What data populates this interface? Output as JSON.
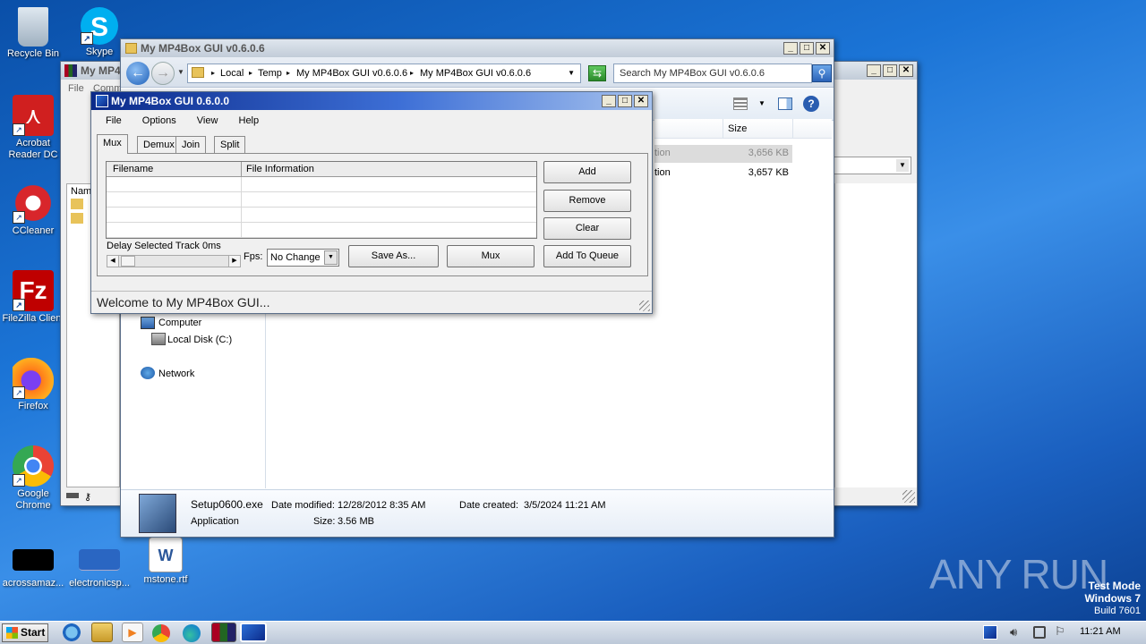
{
  "desktop_icons": [
    {
      "label": "Recycle Bin"
    },
    {
      "label": "Skype"
    },
    {
      "label": "Acrobat Reader DC"
    },
    {
      "label": "CCleaner"
    },
    {
      "label": "FileZilla Client"
    },
    {
      "label": "Firefox"
    },
    {
      "label": "Google Chrome"
    },
    {
      "label": "acrossamaz..."
    },
    {
      "label": "electronicsp..."
    },
    {
      "label": "mstone.rtf"
    }
  ],
  "back_window": {
    "title": "My MP4",
    "menu_file": "File",
    "menu_comm": "Comm",
    "col_name": "Name"
  },
  "explorer": {
    "title": "My MP4Box GUI v0.6.0.6",
    "address": [
      "Local",
      "Temp",
      "My MP4Box GUI v0.6.0.6",
      "My MP4Box GUI v0.6.0.6"
    ],
    "search_placeholder": "Search My MP4Box GUI v0.6.0.6",
    "col_size": "Size",
    "files": [
      {
        "type": "tion",
        "size": "3,656 KB"
      },
      {
        "type": "tion",
        "size": "3,657 KB"
      }
    ],
    "nav": {
      "computer": "Computer",
      "local_disk": "Local Disk (C:)",
      "network": "Network"
    },
    "details": {
      "filename": "Setup0600.exe",
      "type": "Application",
      "date_modified_label": "Date modified:",
      "date_modified": "12/28/2012 8:35 AM",
      "date_created_label": "Date created:",
      "date_created": "3/5/2024 11:21 AM",
      "size_label": "Size:",
      "size": "3.56 MB"
    }
  },
  "mp4box": {
    "title": "My MP4Box GUI 0.6.0.0",
    "menu": [
      "File",
      "Options",
      "View",
      "Help"
    ],
    "tabs": [
      "Mux",
      "Demux",
      "Join",
      "Split"
    ],
    "grid_headers": [
      "Filename",
      "File Information"
    ],
    "buttons": {
      "add": "Add",
      "remove": "Remove",
      "clear": "Clear",
      "save_as": "Save As...",
      "mux": "Mux",
      "add_to_queue": "Add To Queue"
    },
    "delay_label": "Delay Selected Track 0ms",
    "fps_label": "Fps:",
    "fps_value": "No Change",
    "status": "Welcome to My MP4Box GUI..."
  },
  "watermark": {
    "brand": "ANY RUN",
    "line1": "Test Mode",
    "line2": "Windows 7",
    "line3": "Build 7601"
  },
  "taskbar": {
    "start": "Start",
    "time": "11:21 AM"
  }
}
